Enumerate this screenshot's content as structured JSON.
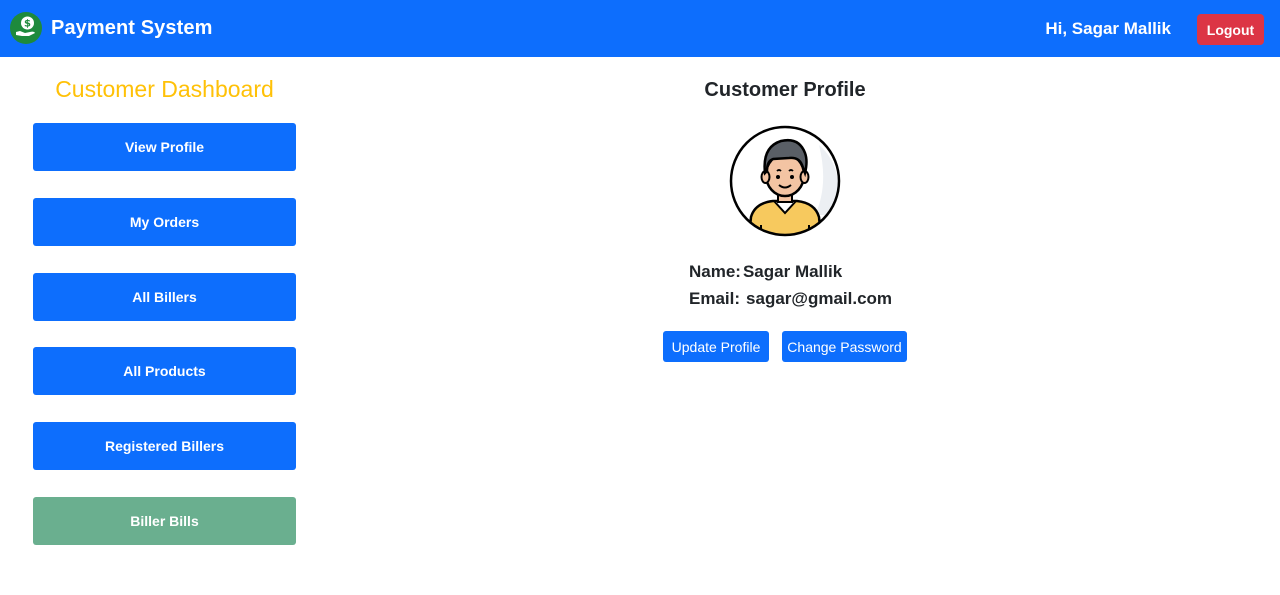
{
  "navbar": {
    "brand": "Payment System",
    "greeting": "Hi, Sagar Mallik",
    "logout_label": "Logout"
  },
  "sidebar": {
    "title": "Customer Dashboard",
    "items": [
      {
        "label": "View Profile"
      },
      {
        "label": "My Orders"
      },
      {
        "label": "All Billers"
      },
      {
        "label": "All Products"
      },
      {
        "label": "Registered Billers"
      },
      {
        "label": "Biller Bills"
      }
    ]
  },
  "profile": {
    "title": "Customer Profile",
    "name_label": "Name:",
    "name_value": "Sagar Mallik",
    "email_label": "Email:",
    "email_value": "sagar@gmail.com",
    "update_label": "Update Profile",
    "change_password_label": "Change Password"
  },
  "colors": {
    "primary": "#0d6efd",
    "danger": "#dc3545",
    "warning": "#ffc107",
    "success_muted": "#6aaf8f"
  }
}
